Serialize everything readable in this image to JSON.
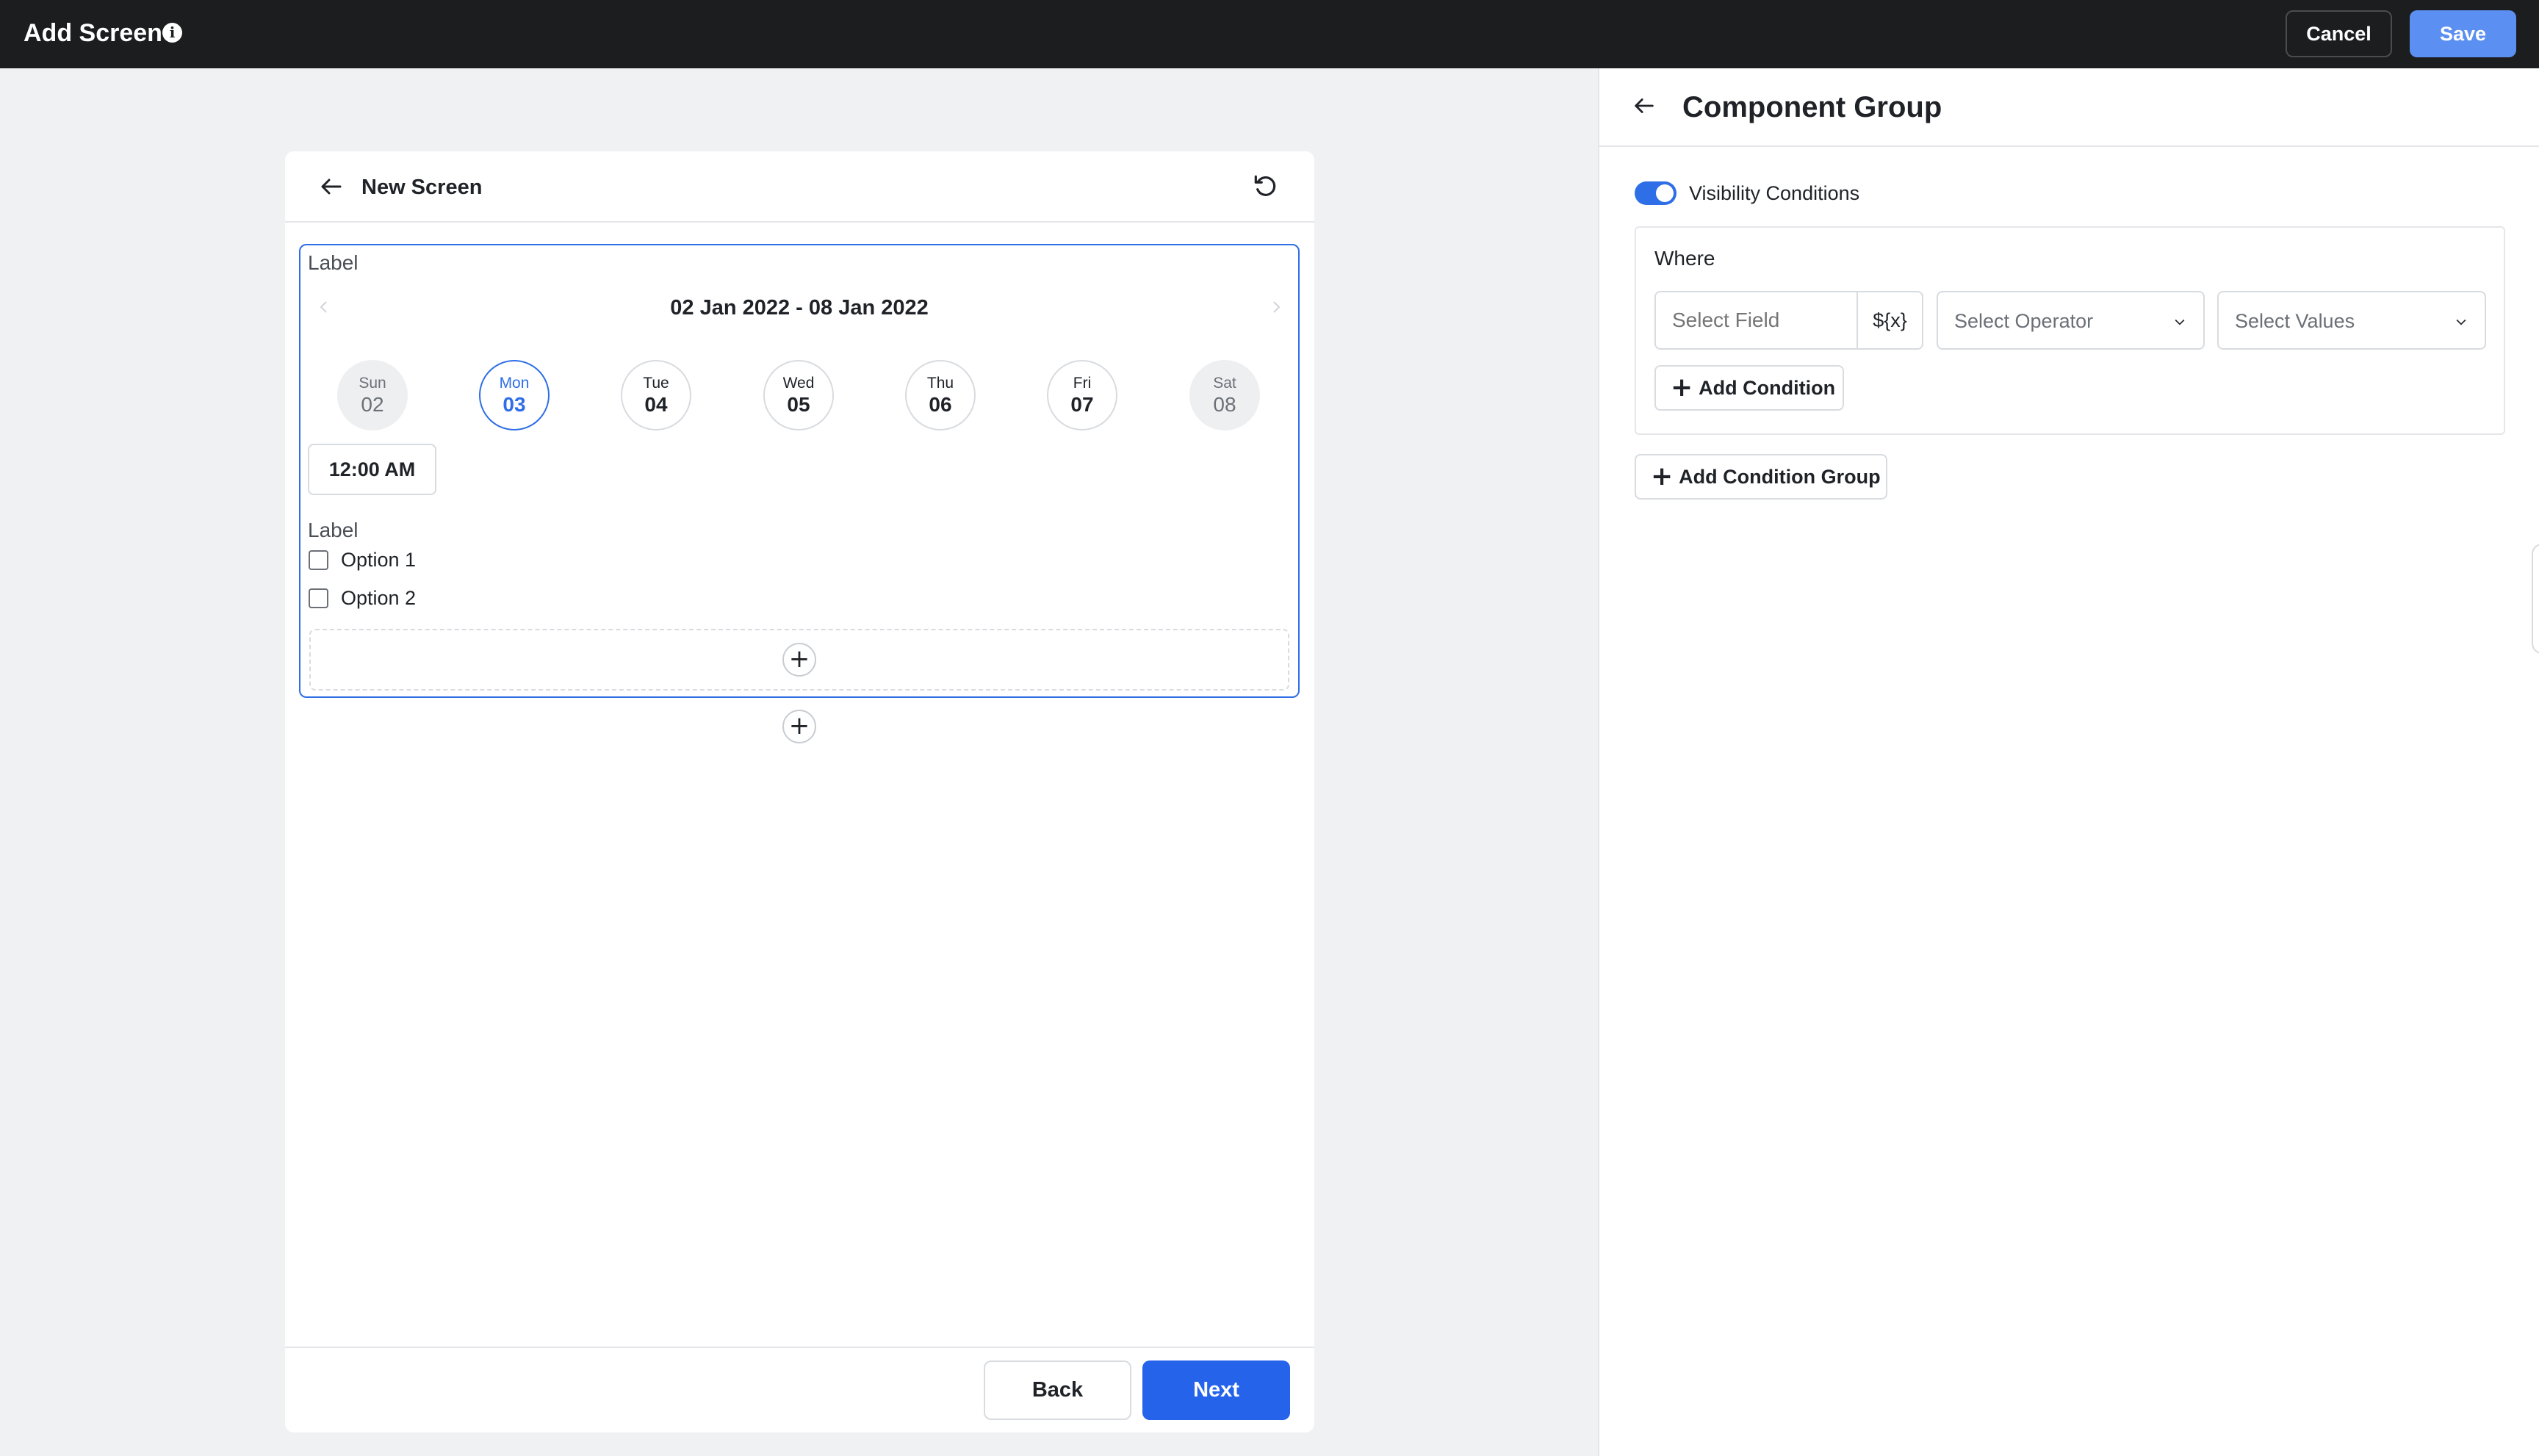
{
  "topbar": {
    "title": "Add Screen",
    "info_icon": "info-icon",
    "cancel_label": "Cancel",
    "save_label": "Save"
  },
  "screen": {
    "title": "New Screen",
    "date_label": "Label",
    "date_range": "02 Jan 2022 - 08 Jan 2022",
    "days": [
      {
        "name": "Sun",
        "num": "02"
      },
      {
        "name": "Mon",
        "num": "03"
      },
      {
        "name": "Tue",
        "num": "04"
      },
      {
        "name": "Wed",
        "num": "05"
      },
      {
        "name": "Thu",
        "num": "06"
      },
      {
        "name": "Fri",
        "num": "07"
      },
      {
        "name": "Sat",
        "num": "08"
      }
    ],
    "selected_day": "Mon",
    "time": "12:00 AM",
    "checkbox_label": "Label",
    "options": [
      "Option 1",
      "Option 2"
    ],
    "back_label": "Back",
    "next_label": "Next"
  },
  "panel": {
    "title": "Component Group",
    "visibility_label": "Visibility Conditions",
    "visibility_on": true,
    "where_label": "Where",
    "field_placeholder": "Select Field",
    "variable_button": "${x}",
    "operator_placeholder": "Select Operator",
    "values_placeholder": "Select Values",
    "add_condition": "Add Condition",
    "add_condition_group": "Add Condition Group"
  },
  "colors": {
    "topbar": "#1c1d1f",
    "accent": "#2e6ee6",
    "save_button": "#5b8ff1",
    "next_button": "#2563eb"
  }
}
